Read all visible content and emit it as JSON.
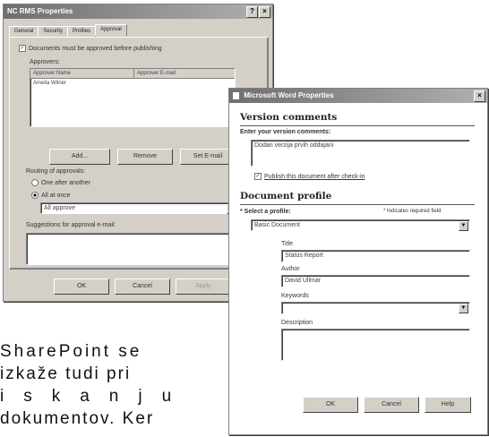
{
  "props_win": {
    "title": "NC RMS Properties",
    "tabs": [
      "General",
      "Security",
      "Profiles",
      "Approval"
    ],
    "require_checkbox_label": "Documents must be approved before publishing",
    "approvers_label": "Approvers:",
    "columns": [
      "Approver Name",
      "Approver E-mail"
    ],
    "rows": [
      [
        "Amelia Wilner",
        ""
      ]
    ],
    "add_label": "Add...",
    "remove_label": "Remove",
    "set_email_label": "Set E-mail",
    "routing_label": "Routing of approvals:",
    "serial_label": "One after another",
    "parallel_label": "All at once",
    "parallel_option": "All approve",
    "suggestions_label": "Suggestions for approval e-mail:",
    "ok_label": "OK",
    "cancel_label": "Cancel",
    "apply_label": "Apply"
  },
  "profile_win": {
    "title": "Microsoft Word Properties",
    "version_heading": "Version comments",
    "version_prompt": "Enter your version comments:",
    "version_value": "Dodan verzija prvih oddajani",
    "publish_label": "Publish this document after check-in",
    "profile_heading": "Document profile",
    "select_label": "Select a profile:",
    "required_note": "Indicates required field",
    "profile_value": "Basic Document",
    "title_label": "Title",
    "title_value": "Status Report",
    "author_label": "Author",
    "author_value": "David Ullmar",
    "keywords_label": "Keywords",
    "keywords_value": "",
    "description_label": "Description",
    "description_value": "",
    "ok_label": "OK",
    "cancel_label": "Cancel",
    "help_label": "Help"
  },
  "page_text": {
    "line1": "SharePoint se",
    "line2": "izkaže tudi pri",
    "line3": "iskanju",
    "line4": "dokumentov. Ker"
  }
}
